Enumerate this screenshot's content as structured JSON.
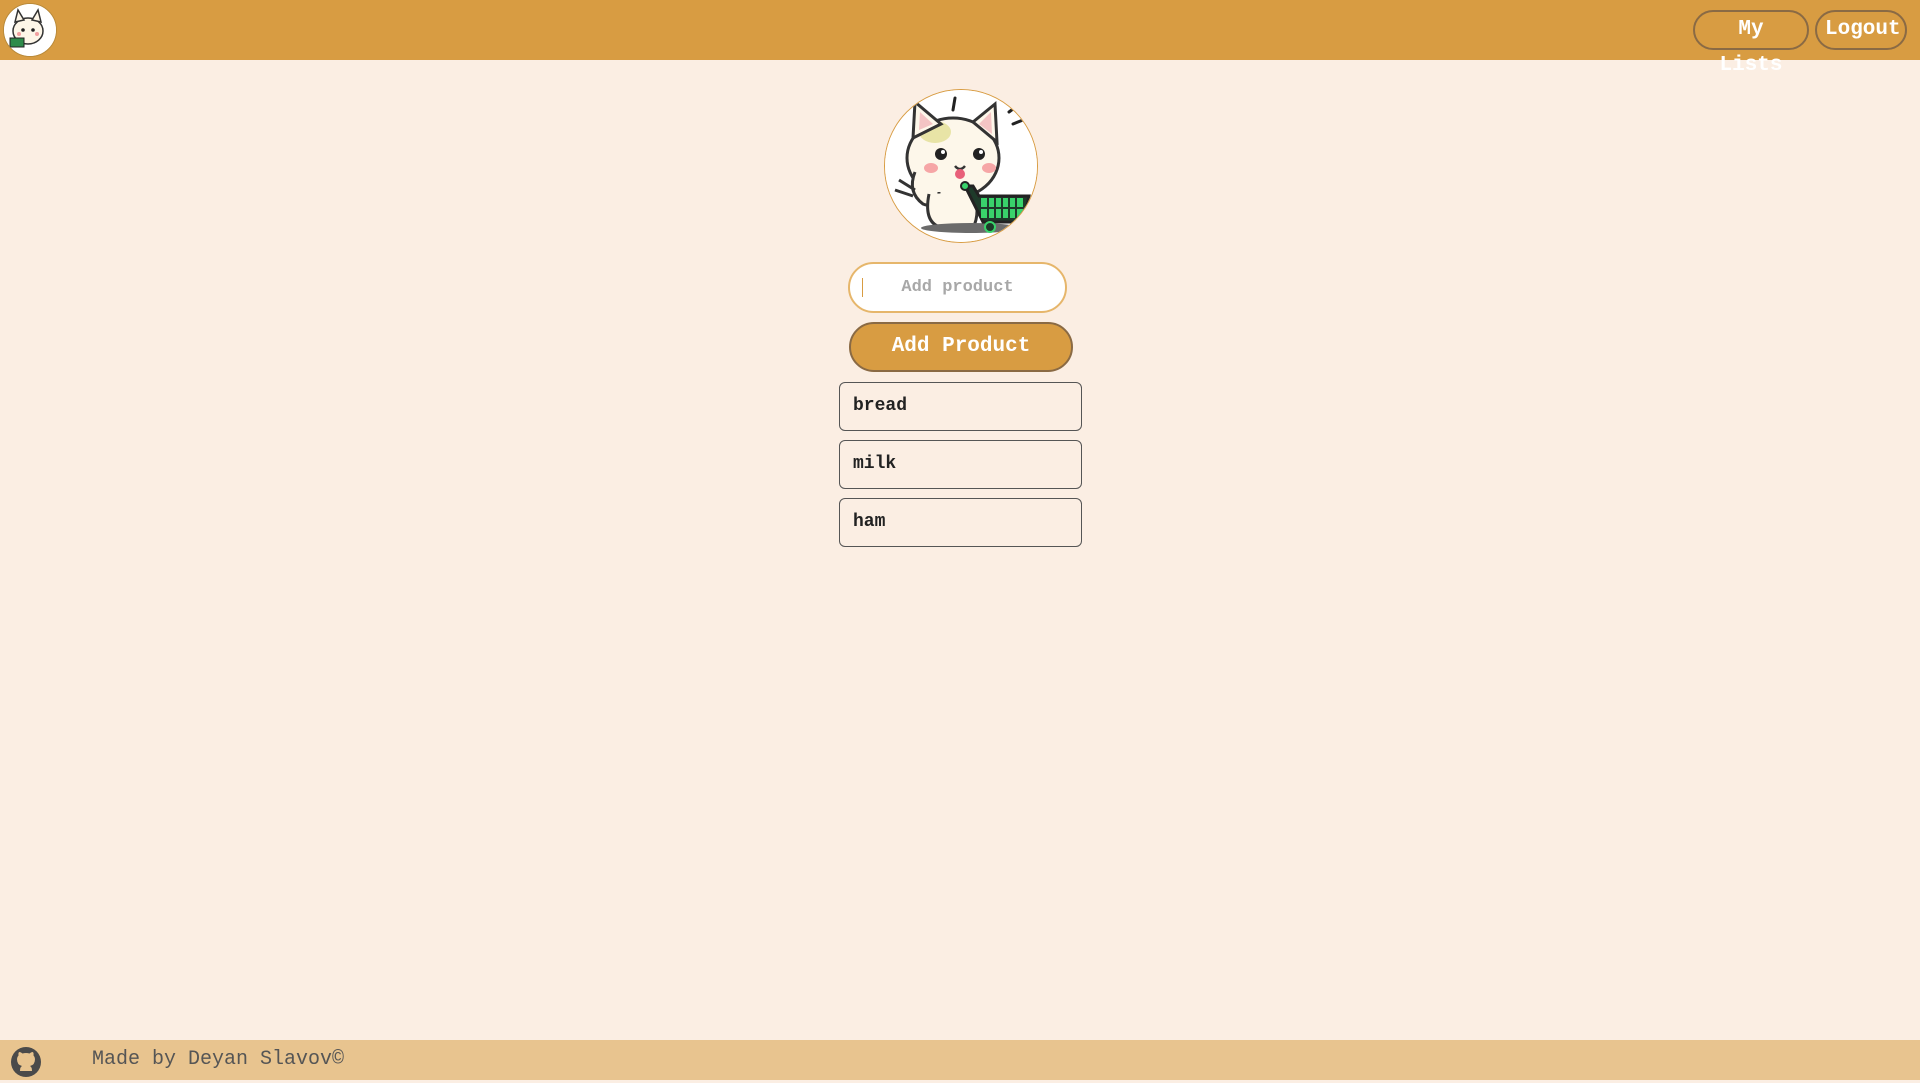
{
  "header": {
    "logo_icon": "cat-shopping-cart-logo",
    "nav": {
      "my_lists_label": "My Lists",
      "logout_label": "Logout"
    }
  },
  "main": {
    "hero_image": "cat-with-shopping-cart-illustration",
    "input": {
      "placeholder": "Add product",
      "value": ""
    },
    "add_button_label": "Add Product",
    "products": [
      {
        "label": "bread"
      },
      {
        "label": "milk"
      },
      {
        "label": "ham"
      }
    ]
  },
  "footer": {
    "github_icon": "github-icon",
    "credit": "Made by Deyan Slavov©"
  },
  "colors": {
    "accent": "#d89c42",
    "background": "#fbeee3",
    "footer": "#e8c48f"
  }
}
